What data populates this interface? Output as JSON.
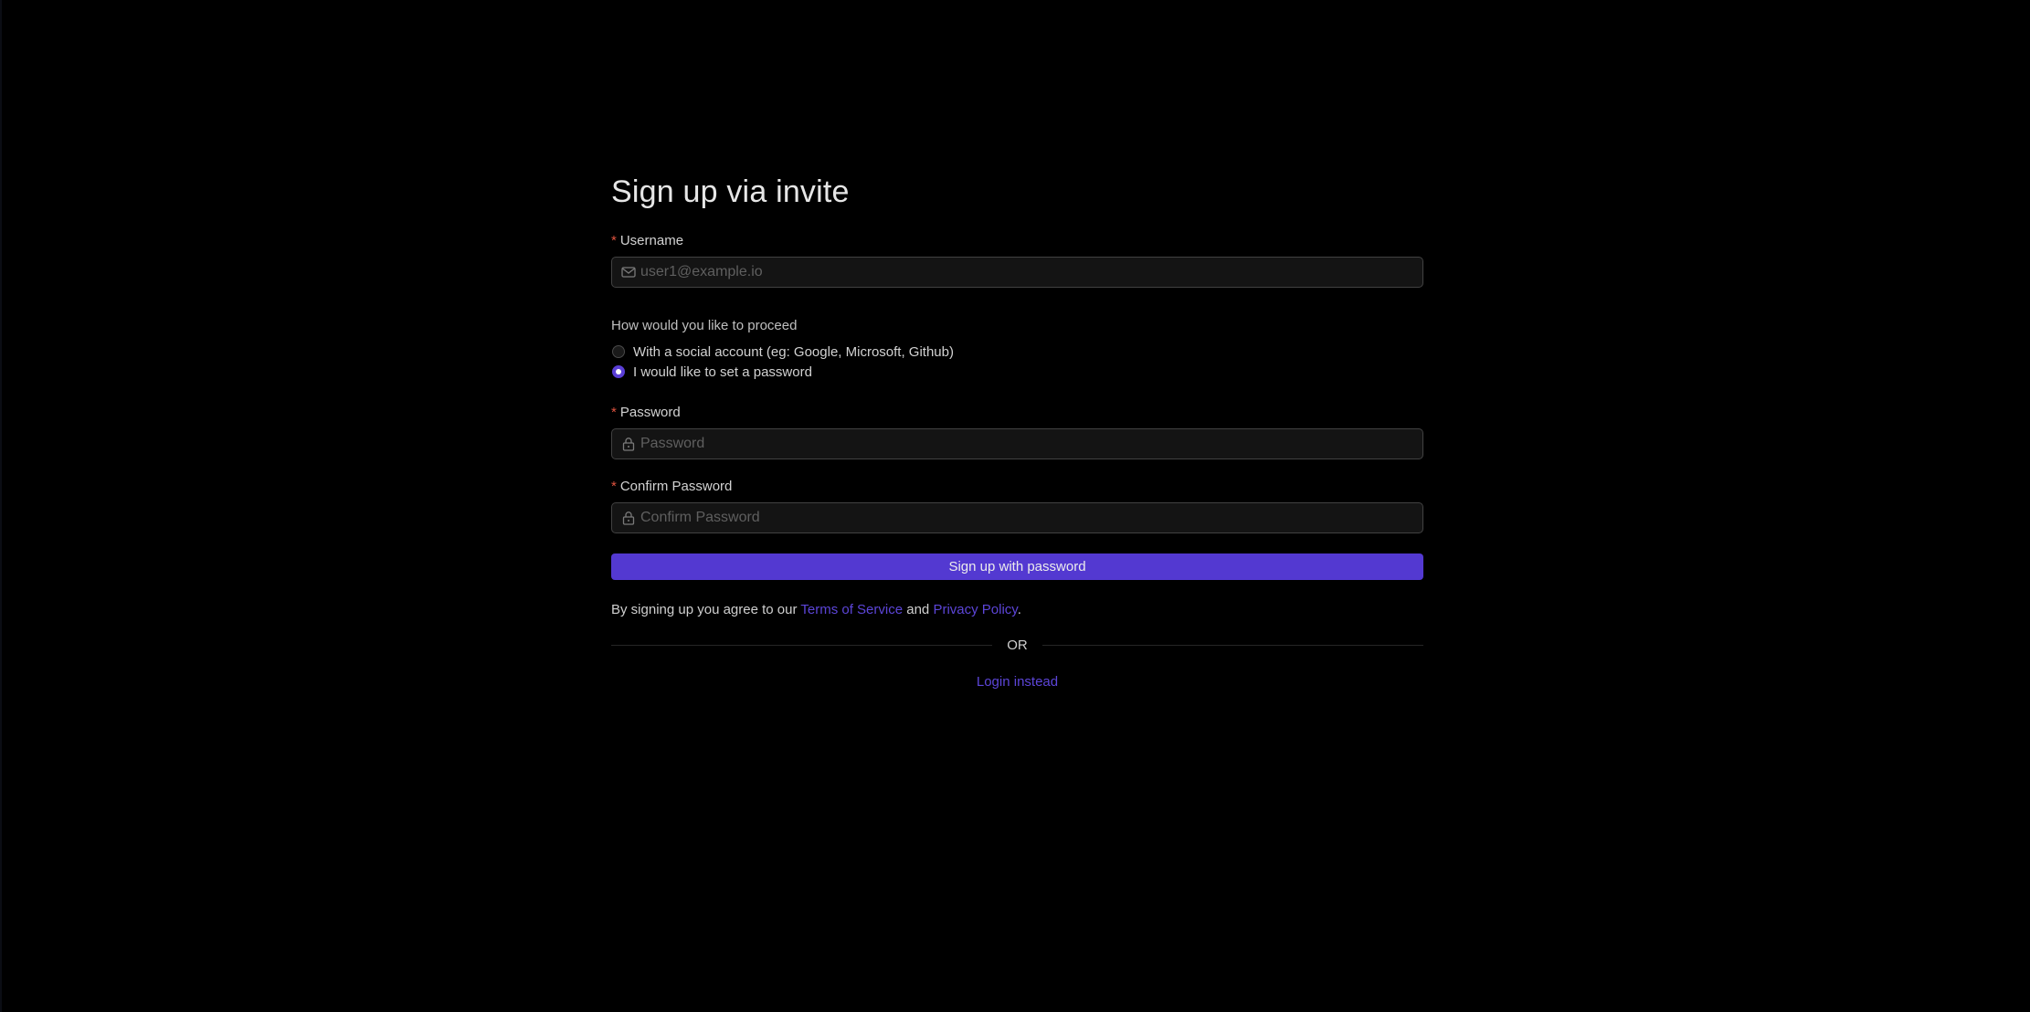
{
  "form": {
    "title": "Sign up via invite",
    "username": {
      "label": "Username",
      "placeholder": "user1@example.io",
      "value": "",
      "icon": "mail-icon"
    },
    "proceed": {
      "question": "How would you like to proceed",
      "options": [
        {
          "label": "With a social account (eg: Google, Microsoft, Github)",
          "selected": false
        },
        {
          "label": "I would like to set a password",
          "selected": true
        }
      ]
    },
    "password": {
      "label": "Password",
      "placeholder": "Password",
      "value": "",
      "icon": "lock-icon"
    },
    "confirm_password": {
      "label": "Confirm Password",
      "placeholder": "Confirm Password",
      "value": "",
      "icon": "lock-icon"
    },
    "submit_label": "Sign up with password",
    "terms": {
      "prefix": "By signing up you agree to our ",
      "tos_link": "Terms of Service",
      "middle": " and ",
      "privacy_link": "Privacy Policy",
      "suffix": "."
    },
    "or_text": "OR",
    "login_link": "Login instead"
  },
  "colors": {
    "background": "#000000",
    "accent": "#5339d1",
    "required": "#e0533f",
    "link": "#5c45d8"
  }
}
